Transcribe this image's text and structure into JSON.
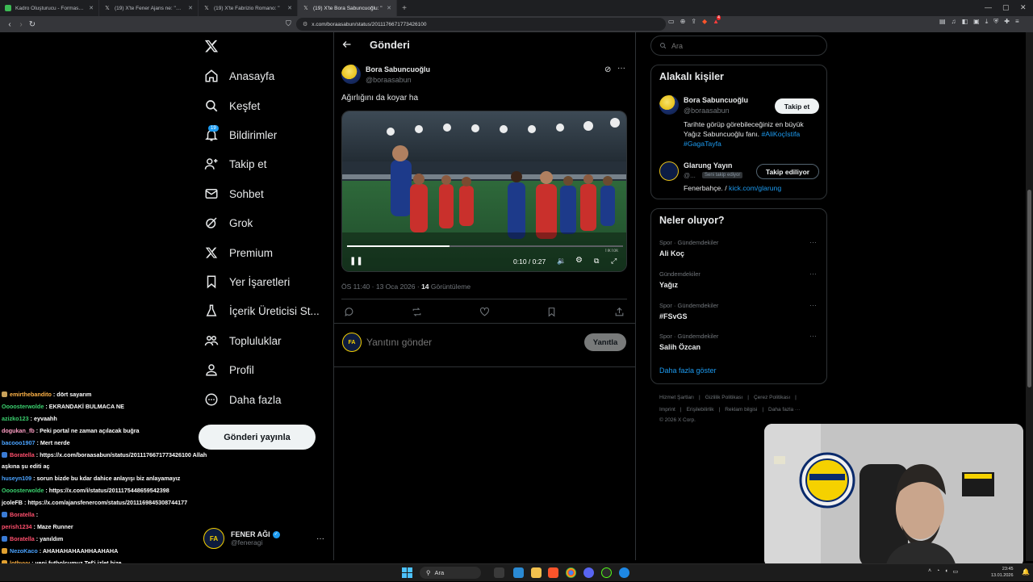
{
  "browser": {
    "tabs": [
      {
        "title": "Kadro Oluşturucu - Formasyonlar ve",
        "active": false
      },
      {
        "title": "(19) X'te Fener Ajans ne: \"Fenerbahçe",
        "active": false
      },
      {
        "title": "(19) X'te Fabrizio Romano: \"",
        "active": false
      },
      {
        "title": "(19) X'te Bora Sabuncuoğlu: \"",
        "active": true
      }
    ],
    "url": "x.com/boraasabun/status/2011176671773426100",
    "notification_count": "4"
  },
  "sidebar": {
    "items": [
      {
        "label": "Anasayfa",
        "icon": "home-icon"
      },
      {
        "label": "Keşfet",
        "icon": "search-icon"
      },
      {
        "label": "Bildirimler",
        "icon": "bell-icon",
        "badge": "19"
      },
      {
        "label": "Takip et",
        "icon": "person-add-icon"
      },
      {
        "label": "Sohbet",
        "icon": "mail-icon"
      },
      {
        "label": "Grok",
        "icon": "grok-icon"
      },
      {
        "label": "Premium",
        "icon": "x-logo-icon"
      },
      {
        "label": "Yer İşaretleri",
        "icon": "bookmark-icon"
      },
      {
        "label": "İçerik Üreticisi St...",
        "icon": "flask-icon"
      },
      {
        "label": "Topluluklar",
        "icon": "communities-icon"
      },
      {
        "label": "Profil",
        "icon": "person-icon"
      },
      {
        "label": "Daha fazla",
        "icon": "more-circle-icon"
      }
    ],
    "post_button": "Gönderi yayınla",
    "account": {
      "name": "FENER AĞI",
      "handle": "@feneragi"
    }
  },
  "post": {
    "header_title": "Gönderi",
    "author_name": "Bora Sabuncuoğlu",
    "author_handle": "@boraasabun",
    "text": "Ağırlığını da koyar ha",
    "video": {
      "current_time": "0:10",
      "duration": "0:27",
      "progress": 0.37,
      "watermark": "TikTok"
    },
    "meta_time": "ÖS 11:40 · 13 Oca 2026 · ",
    "views_count": "14",
    "views_label": " Görüntüleme",
    "reply_placeholder": "Yanıtını gönder",
    "reply_button": "Yanıtla"
  },
  "right": {
    "search_placeholder": "Ara",
    "related": {
      "title": "Alakalı kişiler",
      "people": [
        {
          "name": "Bora Sabuncuoğlu",
          "handle": "@boraasabun",
          "button": "Takip et",
          "bio_plain": "Tarihte görüp görebileceğiniz en büyük Yağız Sabuncuoğlu fanı. ",
          "bio_tag1": "#AliKoçİstifa",
          "bio_tag2": "#GagaTayfa"
        },
        {
          "name": "Glarung Yayın",
          "handle": "@...",
          "follows_you": "Seni takip ediyor",
          "button": "Takip ediliyor",
          "bio_plain": "Fenerbahçe. / ",
          "bio_link": "kick.com/glarung"
        }
      ]
    },
    "trends": {
      "title": "Neler oluyor?",
      "items": [
        {
          "context": "Spor · Gündemdekiler",
          "name": "Ali Koç"
        },
        {
          "context": "Gündemdekiler",
          "name": "Yağız"
        },
        {
          "context": "Spor · Gündemdekiler",
          "name": "#FSvGS"
        },
        {
          "context": "Spor · Gündemdekiler",
          "name": "Salih Özcan"
        }
      ],
      "show_more": "Daha fazla göster"
    },
    "footer": {
      "links1": [
        "Hizmet Şartları",
        "Gizlilik Politikası",
        "Çerez Politikası"
      ],
      "links2": [
        "Imprint",
        "Erişilebilirlik",
        "Reklam bilgisi",
        "Daha fazla ···"
      ],
      "copyright": "© 2026 X Corp."
    }
  },
  "chat": [
    {
      "user": "emirthebandito",
      "color": "#ffb347",
      "message": " : dört sayarım",
      "badge": "#c8a15a"
    },
    {
      "user": "Oooosterwolde",
      "color": "#3bd16f",
      "message": " : EKRANDAKİ BULMACA NE",
      "badge": ""
    },
    {
      "user": "azizko123",
      "color": "#3bd16f",
      "message": " : eyvaahh",
      "badge": ""
    },
    {
      "user": "dogukan_fb",
      "color": "#ff9ec4",
      "message": " : Peki portal ne zaman açılacak buğra",
      "badge": ""
    },
    {
      "user": "bacooo1907",
      "color": "#4aa3ff",
      "message": " : Mert nerde",
      "badge": ""
    },
    {
      "user": "Boratella",
      "color": "#ff4f6d",
      "message": " : https://x.com/boraasabun/status/2011176671773426100 Allah",
      "badge": "#3a7bd5"
    },
    {
      "user": "",
      "color": "#ffffff",
      "message": "aşkına şu editi aç",
      "badge": ""
    },
    {
      "user": "huseyn109",
      "color": "#4aa3ff",
      "message": " : sorun bizde bu kdar dahice anlayışı biz anlayamayız",
      "badge": ""
    },
    {
      "user": "Oooosterwolde",
      "color": "#3bd16f",
      "message": " : https://x.com/i/status/2011175448659542398",
      "badge": ""
    },
    {
      "user": "jcoleFB",
      "color": "#ffffff",
      "message": " : https://x.com/ajansfenercom/status/2011169845308744177",
      "badge": ""
    },
    {
      "user": "Boratella",
      "color": "#ff4f6d",
      "message": " : ",
      "badge": "#3a7bd5"
    },
    {
      "user": "perish1234",
      "color": "#ff4f6d",
      "message": " : Maze Runner",
      "badge": ""
    },
    {
      "user": "Boratella",
      "color": "#ff4f6d",
      "message": " : yanıldım",
      "badge": "#3a7bd5"
    },
    {
      "user": "NezoKaco",
      "color": "#4aa3ff",
      "message": " : AHAHAHAHAAHHAAHAHA",
      "badge": "#e0a030"
    },
    {
      "user": "lothyyy",
      "color": "#ffb347",
      "message": " : yeni futbolcumuz Tef'i izlet bize",
      "badge": "#e0a030"
    }
  ],
  "taskbar": {
    "search_label": "Ara",
    "time": "23:45",
    "date": "13.01.2026"
  },
  "colors": {
    "accent": "#1d9bf0",
    "bg": "#000000",
    "border": "#2f3336",
    "muted": "#71767b"
  }
}
